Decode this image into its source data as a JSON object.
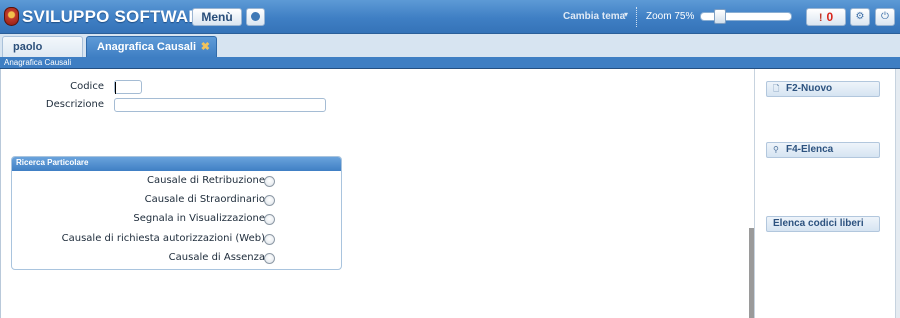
{
  "app": {
    "title": "SVILUPPO SOFTWARE",
    "menu_label": "Menù",
    "theme_label": "Cambia tema",
    "theme_caret": "▾",
    "zoom_label": "Zoom 75%",
    "zoom_value_percent": 75,
    "alert_bang": "!",
    "alert_count": "0",
    "settings_glyph": "⚙",
    "power_glyph": "⏻",
    "accent_color": "#3f7fc4"
  },
  "tabs": [
    {
      "label": "paolo Home",
      "active": false
    },
    {
      "label": "Anagrafica Causali",
      "active": true,
      "close_glyph": "✖"
    }
  ],
  "breadcrumb": "Anagrafica Causali",
  "form": {
    "codice_label": "Codice",
    "codice_value": "",
    "descrizione_label": "Descrizione",
    "descrizione_value": ""
  },
  "ricerca": {
    "title": "Ricerca Particolare",
    "options": [
      {
        "label": "Causale di Retribuzione",
        "checked": false
      },
      {
        "label": "Causale di Straordinario",
        "checked": false
      },
      {
        "label": "Segnala in Visualizzazione",
        "checked": false
      },
      {
        "label": "Causale di richiesta autorizzazioni (Web)",
        "checked": false
      },
      {
        "label": "Causale di Assenza",
        "checked": false
      }
    ]
  },
  "side_actions": [
    {
      "label": "F2-Nuovo",
      "icon": "document-icon",
      "glyph": "🗋"
    },
    {
      "label": "F4-Elenca",
      "icon": "search-icon",
      "glyph": "⚲"
    },
    {
      "label": "Elenca codici liberi",
      "icon": "",
      "glyph": ""
    }
  ]
}
